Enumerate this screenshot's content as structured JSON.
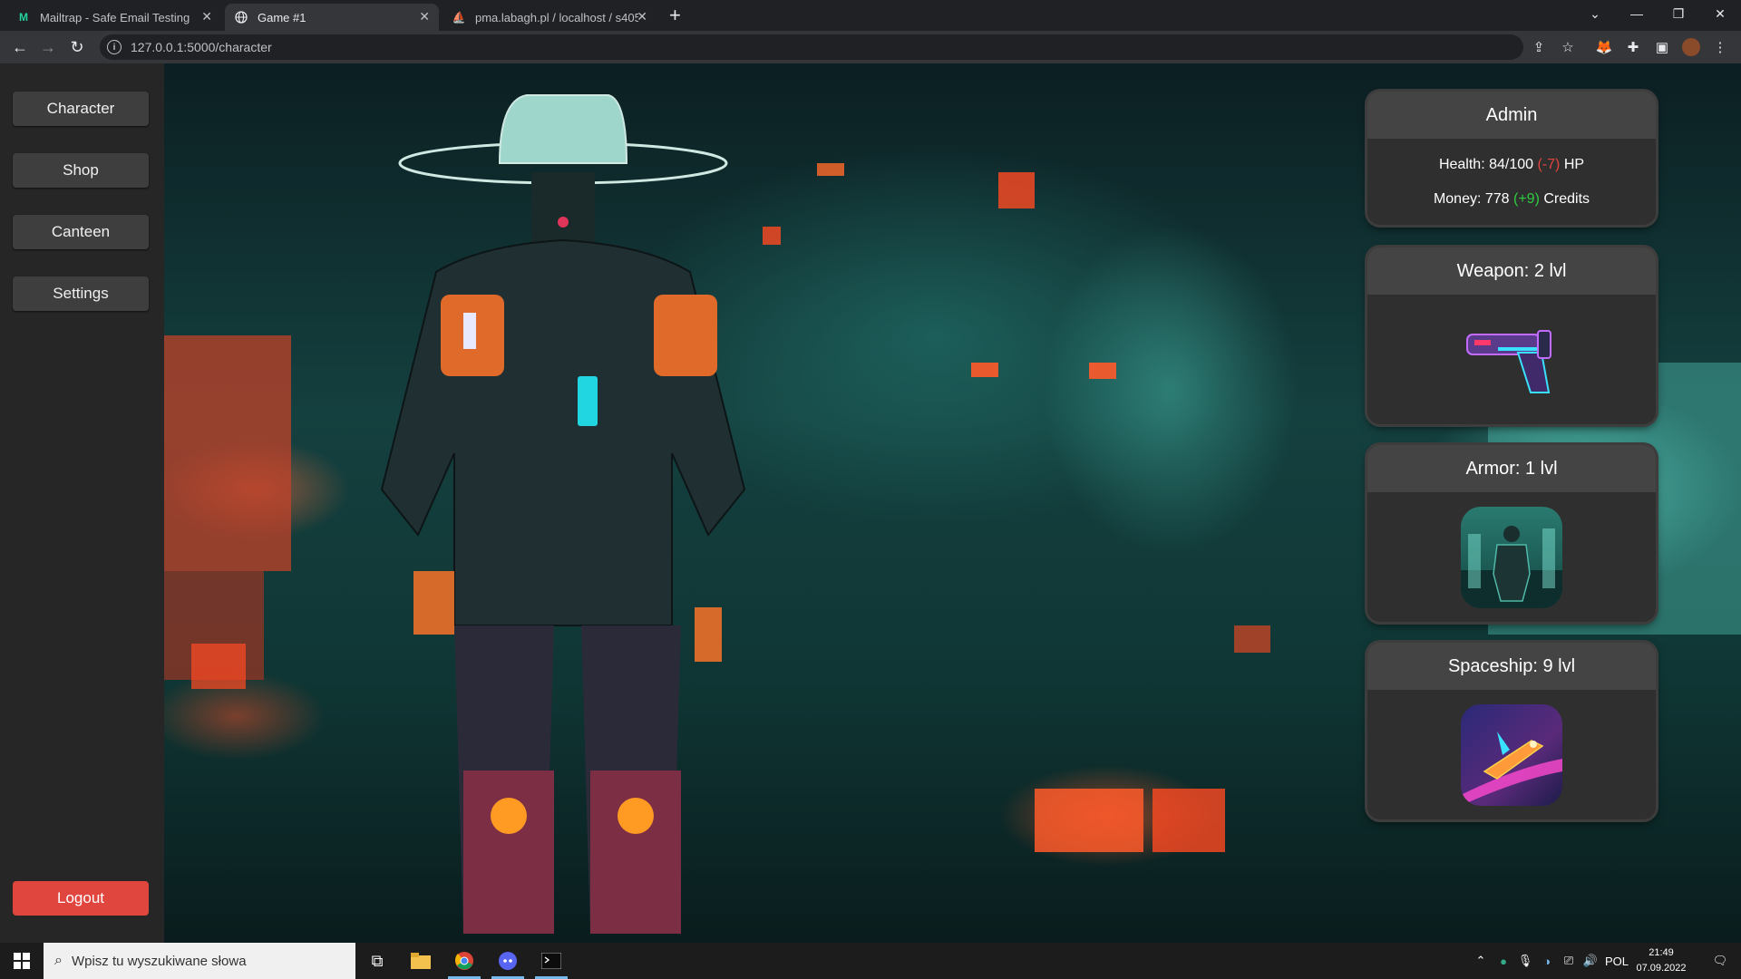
{
  "browser": {
    "tabs": [
      {
        "title": "Mailtrap - Safe Email Testing",
        "active": false
      },
      {
        "title": "Game #1",
        "active": true
      },
      {
        "title": "pma.labagh.pl / localhost / s405",
        "active": false
      }
    ],
    "url": "127.0.0.1:5000/character"
  },
  "sidebar": {
    "items": [
      {
        "label": "Character"
      },
      {
        "label": "Shop"
      },
      {
        "label": "Canteen"
      },
      {
        "label": "Settings"
      }
    ],
    "logout_label": "Logout"
  },
  "player": {
    "name": "Admin",
    "health_prefix": "Health: 84/100",
    "health_delta": "(-7)",
    "health_unit": "HP",
    "money_prefix": "Money: 778",
    "money_delta": "(+9)",
    "money_unit": "Credits"
  },
  "equipment": {
    "weapon_title": "Weapon: 2 lvl",
    "armor_title": "Armor: 1 lvl",
    "spaceship_title": "Spaceship: 9 lvl"
  },
  "taskbar": {
    "search_placeholder": "Wpisz tu wyszukiwane słowa",
    "language": "POL",
    "time": "21:49",
    "date": "07.09.2022"
  },
  "colors": {
    "sidebar_bg": "#262626",
    "button_bg": "#3e3e3e",
    "logout_bg": "#e0463e",
    "card_bg": "#333333",
    "negative": "#e0463e",
    "positive": "#2ecc40"
  },
  "icons": [
    "mailtrap-icon",
    "globe-icon",
    "phpmyadmin-icon",
    "back-arrow-icon",
    "forward-arrow-icon",
    "reload-icon",
    "info-icon",
    "share-icon",
    "star-icon",
    "metamask-icon",
    "puzzle-icon",
    "sidepanel-icon",
    "profile-avatar-icon",
    "menu-dots-icon",
    "windows-start-icon",
    "search-icon",
    "task-view-icon",
    "file-explorer-icon",
    "chrome-icon",
    "discord-icon",
    "terminal-icon"
  ]
}
